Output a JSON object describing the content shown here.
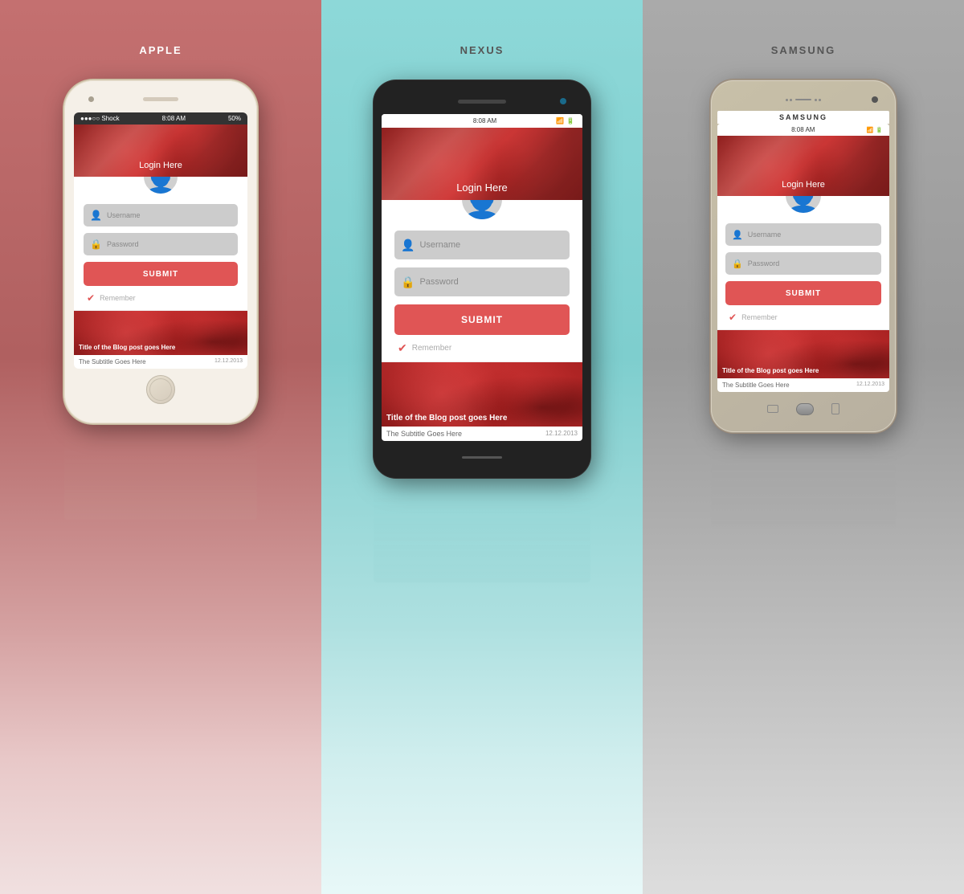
{
  "panels": {
    "apple": {
      "label": "APPLE",
      "status_left": "●●●○○ Shock",
      "status_time": "8:08 AM",
      "status_right": "50%"
    },
    "nexus": {
      "label": "NEXUS",
      "status_time": "8:08 AM"
    },
    "samsung": {
      "label": "SAMSUNG",
      "brand": "SAMSUNG",
      "status_time": "8:08 AM"
    }
  },
  "app": {
    "header_title": "Login Here",
    "username_placeholder": "Username",
    "password_placeholder": "Password",
    "submit_label": "SUBMIT",
    "remember_label": "Remember",
    "blog_title": "Title of the Blog post goes Here",
    "blog_subtitle": "The Subtitle Goes Here",
    "blog_date": "12.12.2013"
  },
  "colors": {
    "submit_bg": "#e05555",
    "header_bg": "#c0504d",
    "check_color": "#e05555"
  }
}
